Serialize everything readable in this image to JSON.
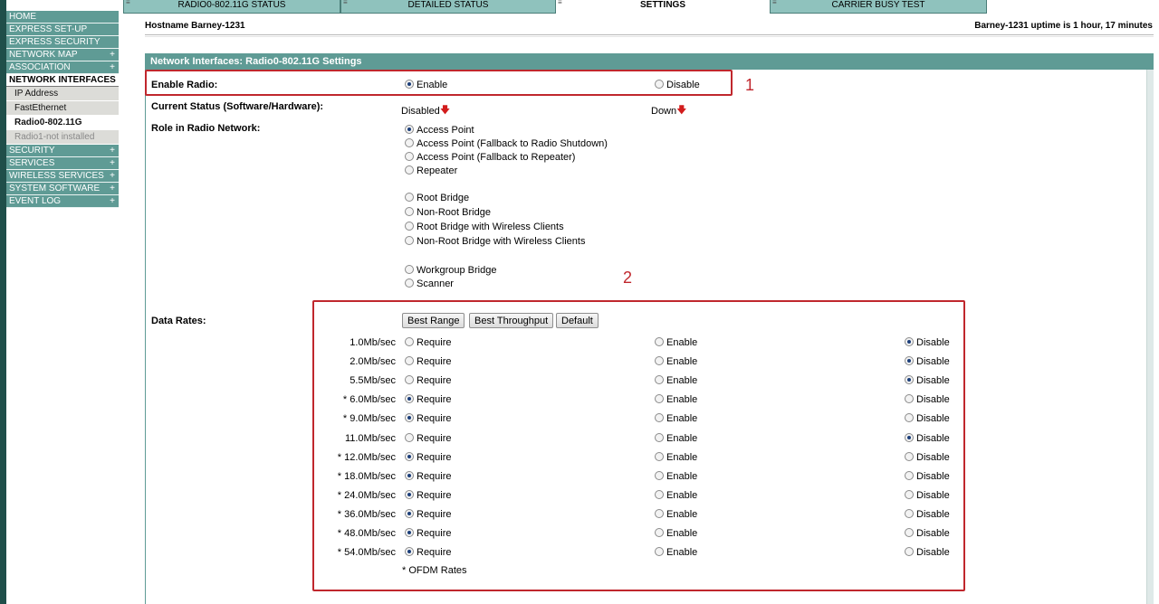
{
  "tabs": [
    {
      "label": "RADIO0-802.11G  STATUS",
      "active": false
    },
    {
      "label": "DETAILED STATUS",
      "active": false
    },
    {
      "label": "SETTINGS",
      "active": true
    },
    {
      "label": "CARRIER BUSY TEST",
      "active": false
    }
  ],
  "sidebar": {
    "items": [
      {
        "label": "HOME",
        "plus": ""
      },
      {
        "label": "EXPRESS SET-UP",
        "plus": ""
      },
      {
        "label": "EXPRESS SECURITY",
        "plus": ""
      },
      {
        "label": "NETWORK MAP",
        "plus": "+"
      },
      {
        "label": "ASSOCIATION",
        "plus": "+"
      },
      {
        "label": "NETWORK INTERFACES",
        "plus": ""
      }
    ],
    "sub_items": [
      {
        "label": "IP Address"
      },
      {
        "label": "FastEthernet"
      },
      {
        "label": "Radio0-802.11G"
      },
      {
        "label": "Radio1-not installed"
      }
    ],
    "items_after": [
      {
        "label": "SECURITY",
        "plus": "+"
      },
      {
        "label": "SERVICES",
        "plus": "+"
      },
      {
        "label": "WIRELESS SERVICES",
        "plus": "+"
      },
      {
        "label": "SYSTEM SOFTWARE",
        "plus": "+"
      },
      {
        "label": "EVENT LOG",
        "plus": "+"
      }
    ]
  },
  "header": {
    "hostname": "Hostname  Barney-1231",
    "uptime": "Barney-1231 uptime is 1 hour, 17 minutes"
  },
  "panel": {
    "title": "Network Interfaces: Radio0-802.11G Settings",
    "enable_radio": {
      "label": "Enable Radio:",
      "enable": "Enable",
      "disable": "Disable",
      "selected": "enable"
    },
    "current_status": {
      "label": "Current Status (Software/Hardware):",
      "software": "Disabled",
      "hardware": "Down"
    },
    "role": {
      "label": "Role in Radio Network:",
      "options": [
        "Access Point",
        "Access Point (Fallback to Radio Shutdown)",
        "Access Point (Fallback to Repeater)",
        "Repeater",
        "Root Bridge",
        "Non-Root Bridge",
        "Root Bridge with Wireless Clients",
        "Non-Root Bridge with Wireless Clients",
        "Workgroup Bridge",
        "Scanner"
      ],
      "selected": "Access Point"
    },
    "data_rates": {
      "label": "Data Rates:",
      "buttons": [
        "Best Range",
        "Best Throughput",
        "Default"
      ],
      "col_require": "Require",
      "col_enable": "Enable",
      "col_disable": "Disable",
      "rates": [
        {
          "rate": "1.0Mb/sec",
          "selected": "disable"
        },
        {
          "rate": "2.0Mb/sec",
          "selected": "disable"
        },
        {
          "rate": "5.5Mb/sec",
          "selected": "disable"
        },
        {
          "rate": "* 6.0Mb/sec",
          "selected": "require"
        },
        {
          "rate": "* 9.0Mb/sec",
          "selected": "require"
        },
        {
          "rate": "11.0Mb/sec",
          "selected": "disable"
        },
        {
          "rate": "* 12.0Mb/sec",
          "selected": "require"
        },
        {
          "rate": "* 18.0Mb/sec",
          "selected": "require"
        },
        {
          "rate": "* 24.0Mb/sec",
          "selected": "require"
        },
        {
          "rate": "* 36.0Mb/sec",
          "selected": "require"
        },
        {
          "rate": "* 48.0Mb/sec",
          "selected": "require"
        },
        {
          "rate": "* 54.0Mb/sec",
          "selected": "require"
        }
      ],
      "footnote": "* OFDM Rates"
    }
  },
  "annotations": {
    "box1_label": "1",
    "box2_label": "2"
  },
  "colors": {
    "teal": "#5f9b95",
    "tab_teal": "#8fc2bd",
    "highlight_red": "#c0272d",
    "arrow_red": "#d21c1c"
  }
}
